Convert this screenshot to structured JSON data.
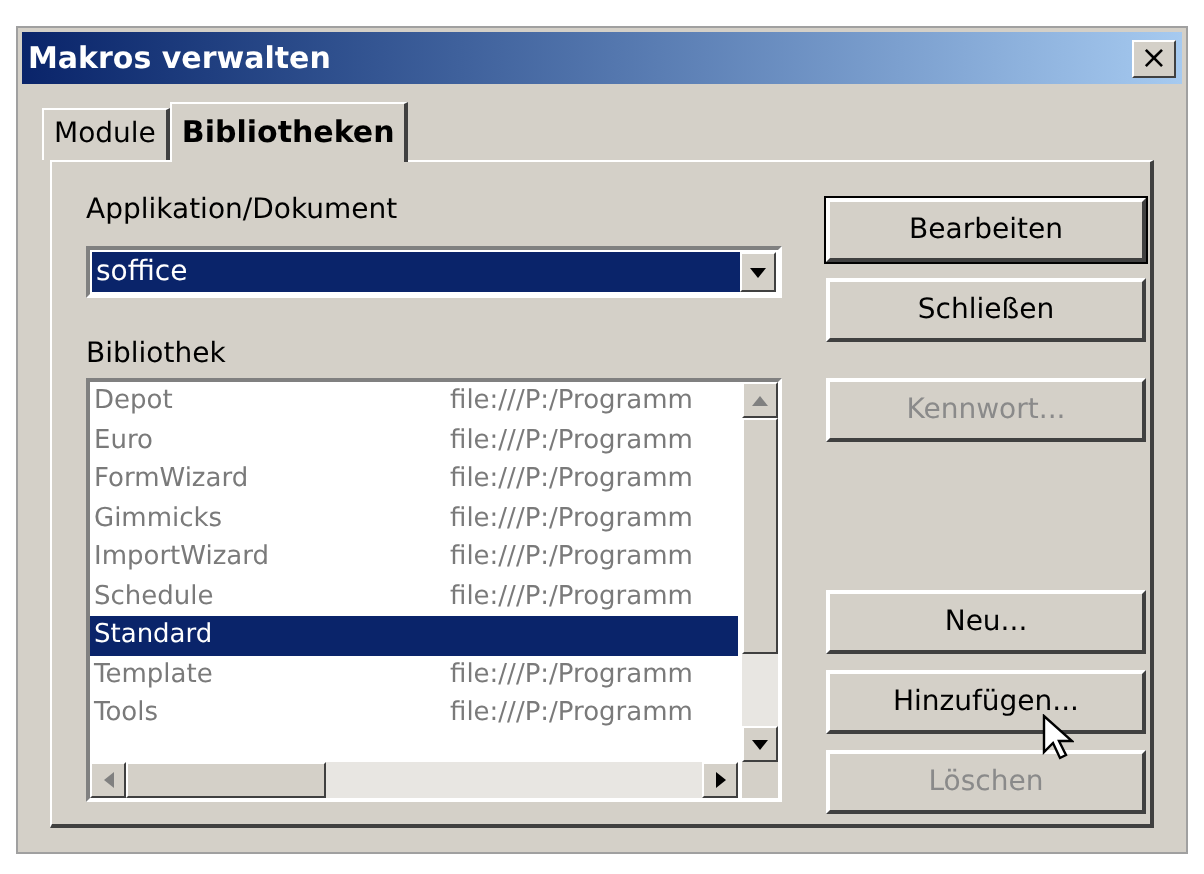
{
  "window": {
    "title": "Makros verwalten",
    "close": "×"
  },
  "tabs": [
    {
      "label": "Module",
      "selected": false
    },
    {
      "label": "Bibliotheken",
      "selected": true
    }
  ],
  "application": {
    "label": "Applikation/Dokument",
    "value": "soffice"
  },
  "library": {
    "label": "Bibliothek",
    "rows": [
      {
        "name": "Depot",
        "location": "file:///P:/Programm",
        "selected": false
      },
      {
        "name": "Euro",
        "location": "file:///P:/Programm",
        "selected": false
      },
      {
        "name": "FormWizard",
        "location": "file:///P:/Programm",
        "selected": false
      },
      {
        "name": "Gimmicks",
        "location": "file:///P:/Programm",
        "selected": false
      },
      {
        "name": "ImportWizard",
        "location": "file:///P:/Programm",
        "selected": false
      },
      {
        "name": "Schedule",
        "location": "file:///P:/Programm",
        "selected": false
      },
      {
        "name": "Standard",
        "selected": true
      },
      {
        "name": "Template",
        "location": "file:///P:/Programm",
        "selected": false
      },
      {
        "name": "Tools",
        "location": "file:///P:/Programm",
        "selected": false
      }
    ]
  },
  "buttons": [
    {
      "label": "Bearbeiten",
      "disabled": false,
      "default": true
    },
    {
      "label": "Schließen",
      "disabled": false,
      "default": false
    },
    {
      "label": "Kennwort...",
      "disabled": true,
      "default": false
    },
    {
      "label": "Neu...",
      "disabled": false,
      "default": false
    },
    {
      "label": "Hinzufügen...",
      "disabled": false,
      "default": false
    },
    {
      "label": "Löschen",
      "disabled": true,
      "default": false
    }
  ]
}
